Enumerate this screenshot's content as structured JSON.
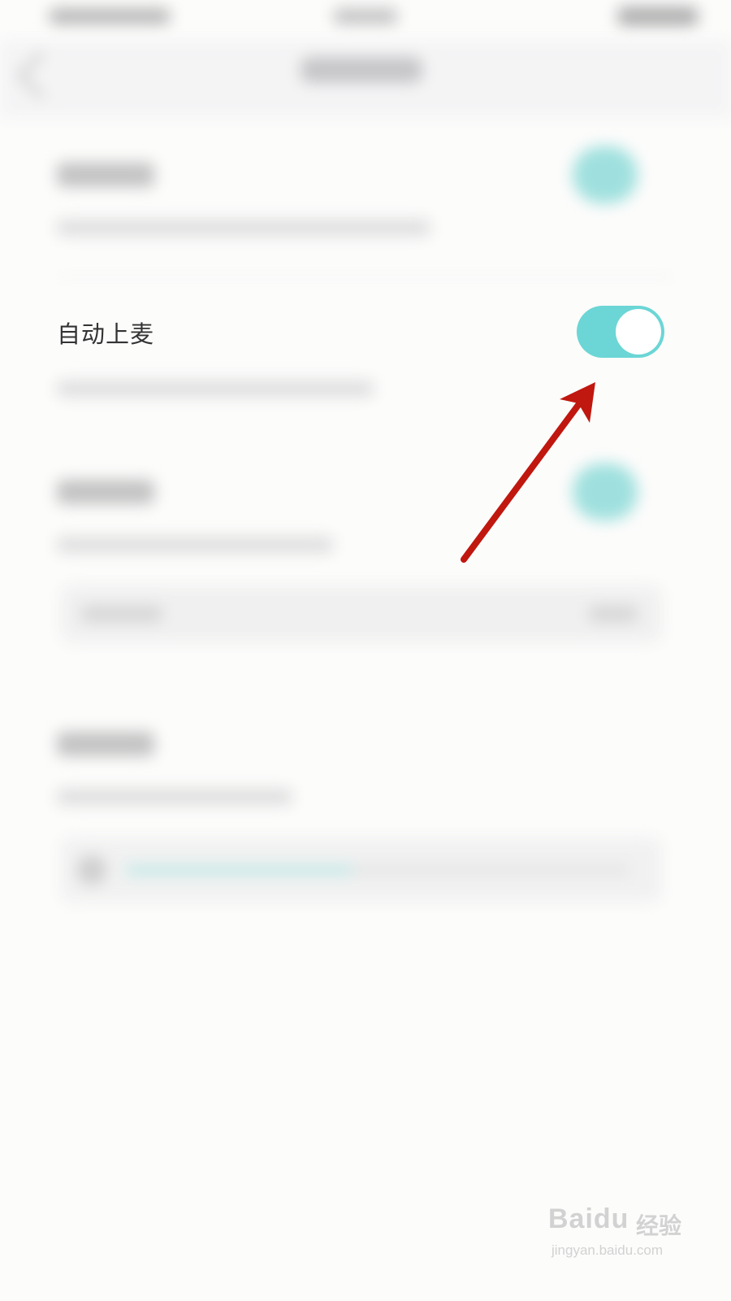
{
  "setting": {
    "title": "自动上麦",
    "toggle_state": "on",
    "toggle_color": "#6bd6d5"
  },
  "slider": {
    "level": 0.45
  },
  "annotation": {
    "arrow_color": "#c0170f"
  },
  "watermark": {
    "brand": "Baidu",
    "brand_cn": "经验",
    "url": "jingyan.baidu.com"
  }
}
